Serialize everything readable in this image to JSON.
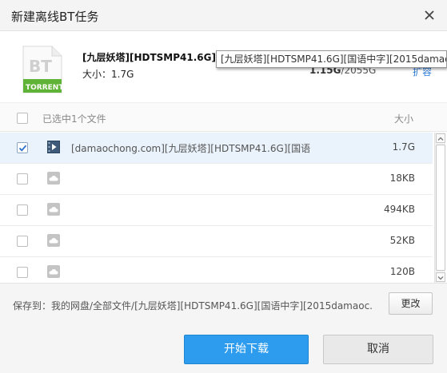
{
  "dialog": {
    "title": "新建离线BT任务",
    "close_icon": "close-icon"
  },
  "torrent": {
    "icon_text_top": "BT",
    "icon_text_bottom": "TORRENT",
    "name": "[九层妖塔][HDTSMP41.6G][国",
    "size_label": "大小：1.7G",
    "disk_used": "1.15G",
    "disk_total": "/2055G",
    "expand_label": "扩容",
    "tooltip": "[九层妖塔][HDTSMP41.6G][国语中字][2015damaoc"
  },
  "list": {
    "header_selected": "已选中1个文件",
    "header_size": "大小",
    "rows": [
      {
        "name": "[damaochong.com][九层妖塔][HDTSMP41.6G][国语...",
        "size": "1.7G",
        "checked": true,
        "icon": "video-file-icon"
      },
      {
        "name": "",
        "size": "18KB",
        "checked": false,
        "icon": "cloud-file-icon"
      },
      {
        "name": "",
        "size": "494KB",
        "checked": false,
        "icon": "cloud-file-icon"
      },
      {
        "name": "",
        "size": "52KB",
        "checked": false,
        "icon": "cloud-file-icon"
      },
      {
        "name": "",
        "size": "120B",
        "checked": false,
        "icon": "cloud-file-icon"
      }
    ]
  },
  "footer": {
    "save_to": "保存到：我的网盘/全部文件/[九层妖塔][HDTSMP41.6G][国语中字][2015damaoc...",
    "change_label": "更改",
    "start_label": "开始下载",
    "cancel_label": "取消"
  },
  "colors": {
    "accent": "#2d9cee",
    "torrent_green": "#5fb336",
    "link": "#2d7ad6"
  }
}
